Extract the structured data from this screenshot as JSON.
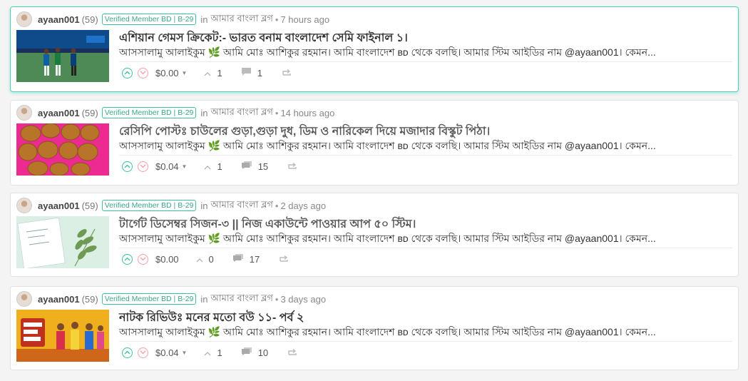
{
  "colors": {
    "accent": "#3cc0a0",
    "downvote": "#f2a0a8",
    "active_border": "#4fd1b7"
  },
  "posts": [
    {
      "author": "ayaan001",
      "reputation": "(59)",
      "badge": "Verified Member BD | B-29",
      "in_label": "in",
      "community": "আমার বাংলা ব্লগ",
      "dot": "•",
      "time": "7 hours ago",
      "title": "এশিয়ান গেমস ক্রিকেট:- ভারত বনাম বাংলাদেশ সেমি ফাইনাল ১।",
      "body": "আসসালামু আলাইকুম 🌿 আমি মোঃ আশিকুর রহমান। আমি বাংলাদেশ ʙᴅ থেকে বলছি। আমার স্টিম আইডির নাম @ayaan001। কেমন...",
      "payout": "$0.00",
      "votes": "1",
      "comments": "1",
      "thumbnail": "cricket-photo"
    },
    {
      "author": "ayaan001",
      "reputation": "(59)",
      "badge": "Verified Member BD | B-29",
      "in_label": "in",
      "community": "আমার বাংলা ব্লগ",
      "dot": "•",
      "time": "14 hours ago",
      "title": "রেসিপি পোস্টঃ চাউলের গুড়া,গুড়া দুধ, ডিম ও নারিকেল দিয়ে মজাদার বিস্কুট পিঠা।",
      "body": "আসসালামু আলাইকুম 🌿 আমি মোঃ আশিকুর রহমান। আমি বাংলাদেশ ʙᴅ থেকে বলছি। আমার স্টিম আইডির নাম @ayaan001। কেমন...",
      "payout": "$0.04",
      "votes": "1",
      "comments": "15",
      "thumbnail": "biscuit-pitha-photo"
    },
    {
      "author": "ayaan001",
      "reputation": "(59)",
      "badge": "Verified Member BD | B-29",
      "in_label": "in",
      "community": "আমার বাংলা ব্লগ",
      "dot": "•",
      "time": "2 days ago",
      "title": "টার্গেট ডিসেম্বর সিজন-৩ || নিজ একাউন্টে পাওয়ার আপ ৫০ স্টিম।",
      "body": "আসসালামু আলাইকুম 🌿 আমি মোঃ আশিকুর রহমান। আমি বাংলাদেশ ʙᴅ থেকে বলছি। আমার স্টিম আইডির নাম @ayaan001। কেমন...",
      "payout": "$0.00",
      "votes": "0",
      "comments": "17",
      "thumbnail": "power-up-card"
    },
    {
      "author": "ayaan001",
      "reputation": "(59)",
      "badge": "Verified Member BD | B-29",
      "in_label": "in",
      "community": "আমার বাংলা ব্লগ",
      "dot": "•",
      "time": "3 days ago",
      "title": "নাটক রিভিউঃ মনের মতো বউ ১১- পর্ব ২",
      "body": "আসসালামু আলাইকুম 🌿 আমি মোঃ আশিকুর রহমান। আমি বাংলাদেশ ʙᴅ থেকে বলছি। আমার স্টিম আইডির নাম @ayaan001। কেমন...",
      "payout": "$0.04",
      "votes": "1",
      "comments": "10",
      "thumbnail": "drama-poster"
    }
  ]
}
